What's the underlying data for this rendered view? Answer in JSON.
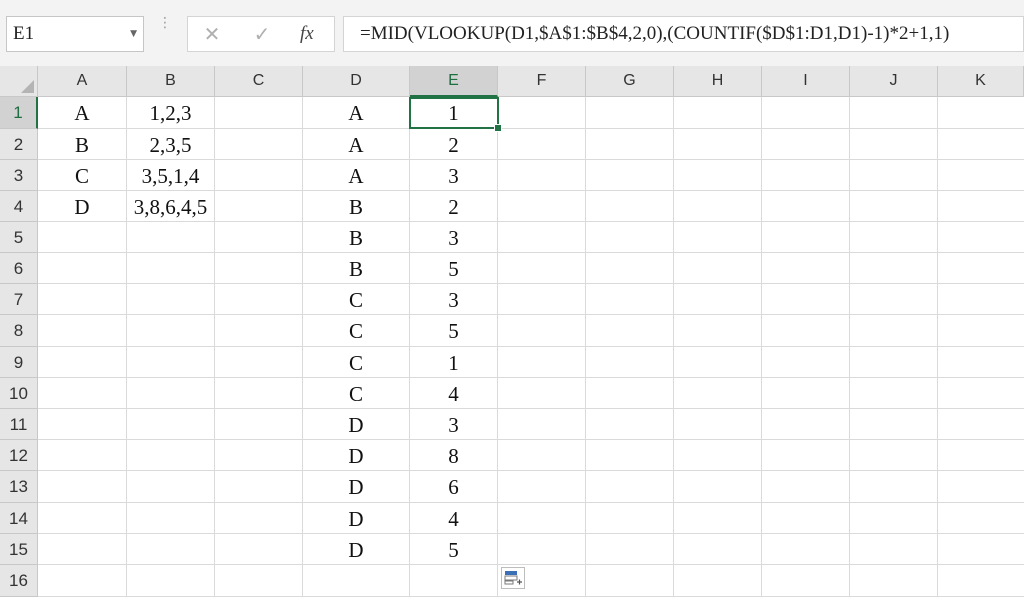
{
  "name_box": {
    "value": "E1"
  },
  "formula_bar": {
    "cancel_glyph": "✕",
    "enter_glyph": "✓",
    "fx_label": "fx",
    "formula": "=MID(VLOOKUP(D1,$A$1:$B$4,2,0),(COUNTIF($D$1:D1,D1)-1)*2+1,1)"
  },
  "columns": [
    "A",
    "B",
    "C",
    "D",
    "E",
    "F",
    "G",
    "H",
    "I",
    "J",
    "K"
  ],
  "rows": [
    "1",
    "2",
    "3",
    "4",
    "5",
    "6",
    "7",
    "8",
    "9",
    "10",
    "11",
    "12",
    "13",
    "14",
    "15",
    "16"
  ],
  "selected": {
    "column": "E",
    "row": "1",
    "cell": "E1"
  },
  "cells": {
    "A": [
      "A",
      "B",
      "C",
      "D"
    ],
    "B": [
      "1,2,3",
      "2,3,5",
      "3,5,1,4",
      "3,8,6,4,5"
    ],
    "D": [
      "A",
      "A",
      "A",
      "B",
      "B",
      "B",
      "C",
      "C",
      "C",
      "C",
      "D",
      "D",
      "D",
      "D",
      "D"
    ],
    "E": [
      "1",
      "2",
      "3",
      "2",
      "3",
      "5",
      "3",
      "5",
      "1",
      "4",
      "3",
      "8",
      "6",
      "4",
      "5"
    ]
  },
  "icons": {
    "name_box_dropdown": "chevron-down-icon",
    "cancel": "close-icon",
    "enter": "check-icon",
    "function": "function-icon",
    "quick_analysis": "quick-analysis-icon"
  },
  "colors": {
    "selection": "#217346",
    "header_bg": "#e6e6e6",
    "grid": "#dadada"
  }
}
